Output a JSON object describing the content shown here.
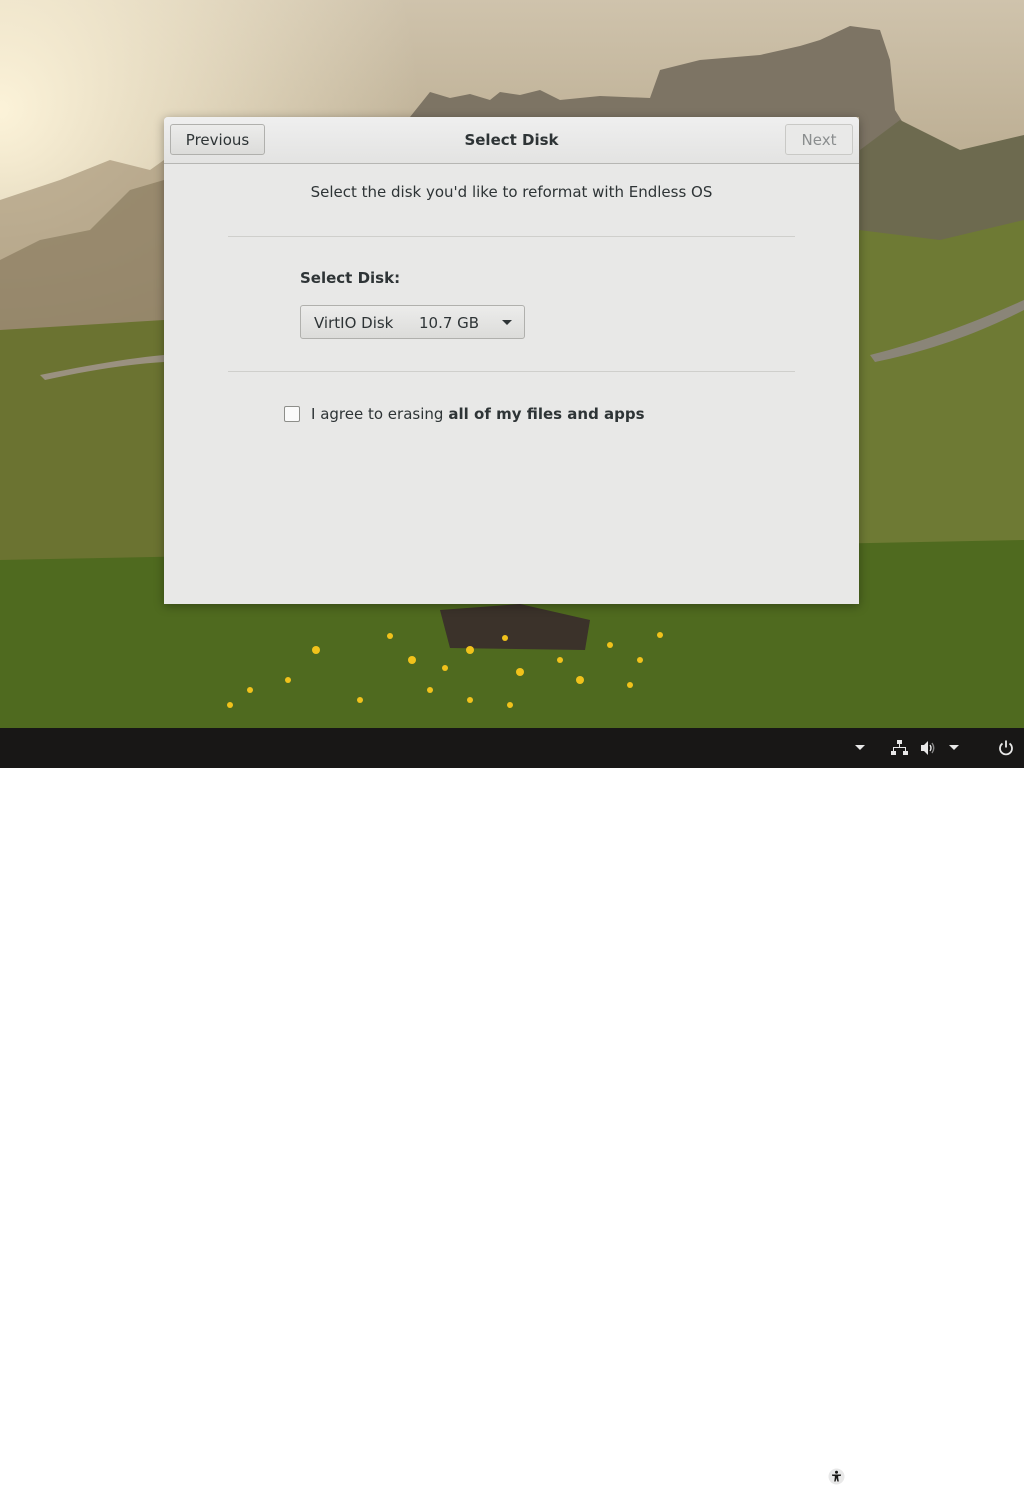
{
  "dialog": {
    "title": "Select Disk",
    "previous_label": "Previous",
    "next_label": "Next",
    "subtitle": "Select the disk you'd like to reformat with Endless OS",
    "select_disk_label": "Select Disk:",
    "disk_combo": {
      "disk_name": "VirtIO Disk",
      "disk_size": "10.7 GB"
    },
    "agree": {
      "text": "I agree to erasing",
      "bold_text": "all of my files and apps",
      "checked": false
    }
  },
  "taskbar": {
    "icons": [
      "accessibility-icon",
      "chevron-down-icon",
      "network-icon",
      "volume-icon",
      "chevron-down-icon",
      "power-icon"
    ]
  },
  "colors": {
    "dialog_bg": "#e8e8e7",
    "taskbar_bg": "#181716",
    "text": "#2e3436",
    "disabled_text": "#8b8e8f"
  }
}
